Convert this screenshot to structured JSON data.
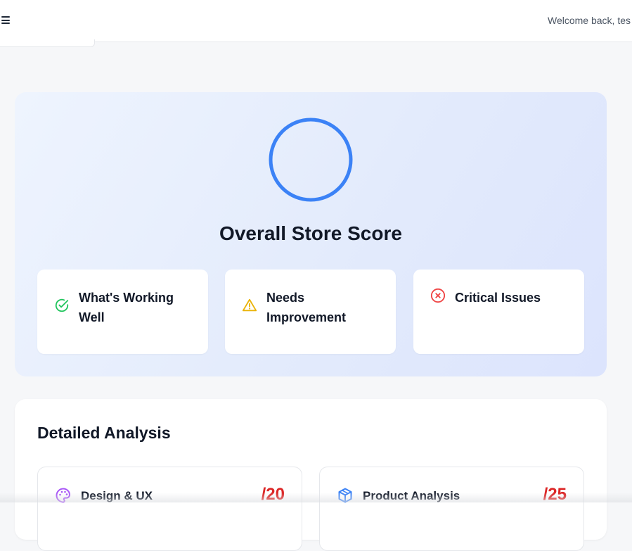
{
  "header": {
    "menu_icon": "hamburger-menu-icon",
    "welcome_text": "Welcome back, tes"
  },
  "hero": {
    "title": "Overall Store Score",
    "ring_color": "#3b82f6",
    "cards": [
      {
        "label": "What's Working Well",
        "icon": "check-circle-icon",
        "color": "#22c55e"
      },
      {
        "label": "Needs Improvement",
        "icon": "warning-triangle-icon",
        "color": "#eab308"
      },
      {
        "label": "Critical Issues",
        "icon": "x-circle-icon",
        "color": "#ef4444"
      }
    ]
  },
  "analysis": {
    "title": "Detailed Analysis",
    "categories": [
      {
        "name": "Design & UX",
        "score": "/20",
        "icon": "palette-icon",
        "color": "#a855f7"
      },
      {
        "name": "Product Analysis",
        "score": "/25",
        "icon": "box-icon",
        "color": "#3b82f6"
      }
    ]
  }
}
